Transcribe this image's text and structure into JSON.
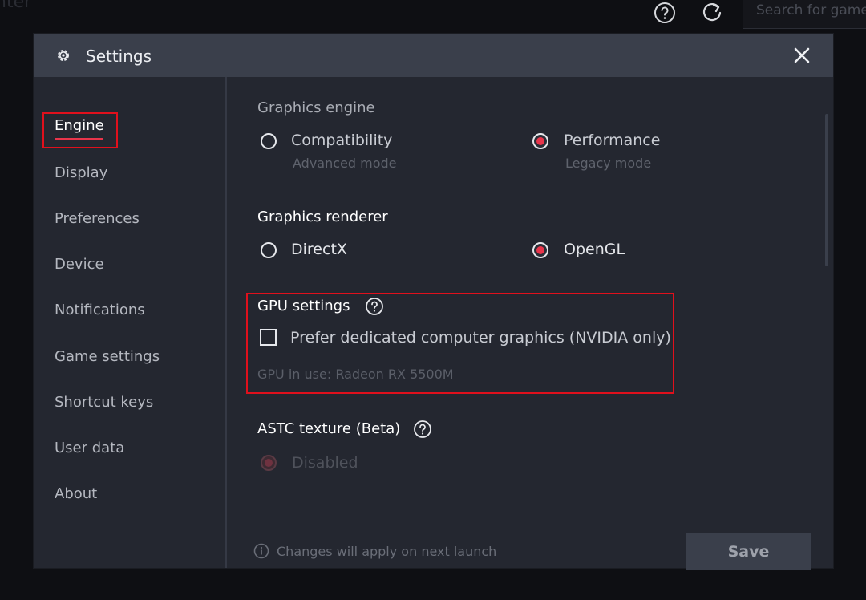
{
  "background": {
    "app_title": "nter",
    "search_placeholder": "Search for games"
  },
  "dialog": {
    "title": "Settings",
    "sidebar": {
      "items": [
        {
          "label": "Engine",
          "active": true
        },
        {
          "label": "Display"
        },
        {
          "label": "Preferences"
        },
        {
          "label": "Device"
        },
        {
          "label": "Notifications"
        },
        {
          "label": "Game settings"
        },
        {
          "label": "Shortcut keys"
        },
        {
          "label": "User data"
        },
        {
          "label": "About"
        }
      ]
    },
    "graphics_engine": {
      "title": "Graphics engine",
      "options": [
        {
          "label": "Compatibility",
          "sub": "Advanced mode",
          "selected": false
        },
        {
          "label": "Performance",
          "sub": "Legacy mode",
          "selected": true
        }
      ]
    },
    "graphics_renderer": {
      "title": "Graphics renderer",
      "options": [
        {
          "label": "DirectX",
          "selected": false
        },
        {
          "label": "OpenGL",
          "selected": true
        }
      ]
    },
    "gpu_settings": {
      "title": "GPU settings",
      "checkbox_label": "Prefer dedicated computer graphics (NVIDIA only)",
      "checked": false,
      "gpu_in_use": "GPU in use: Radeon RX 5500M"
    },
    "astc": {
      "title": "ASTC texture (Beta)",
      "option_label": "Disabled"
    },
    "footer": {
      "note": "Changes will apply on next launch",
      "save_label": "Save"
    },
    "colors": {
      "accent": "#e8354b",
      "highlight_box": "#e0101c",
      "header_bg": "#3a3f4b",
      "panel_bg": "#242730"
    }
  }
}
